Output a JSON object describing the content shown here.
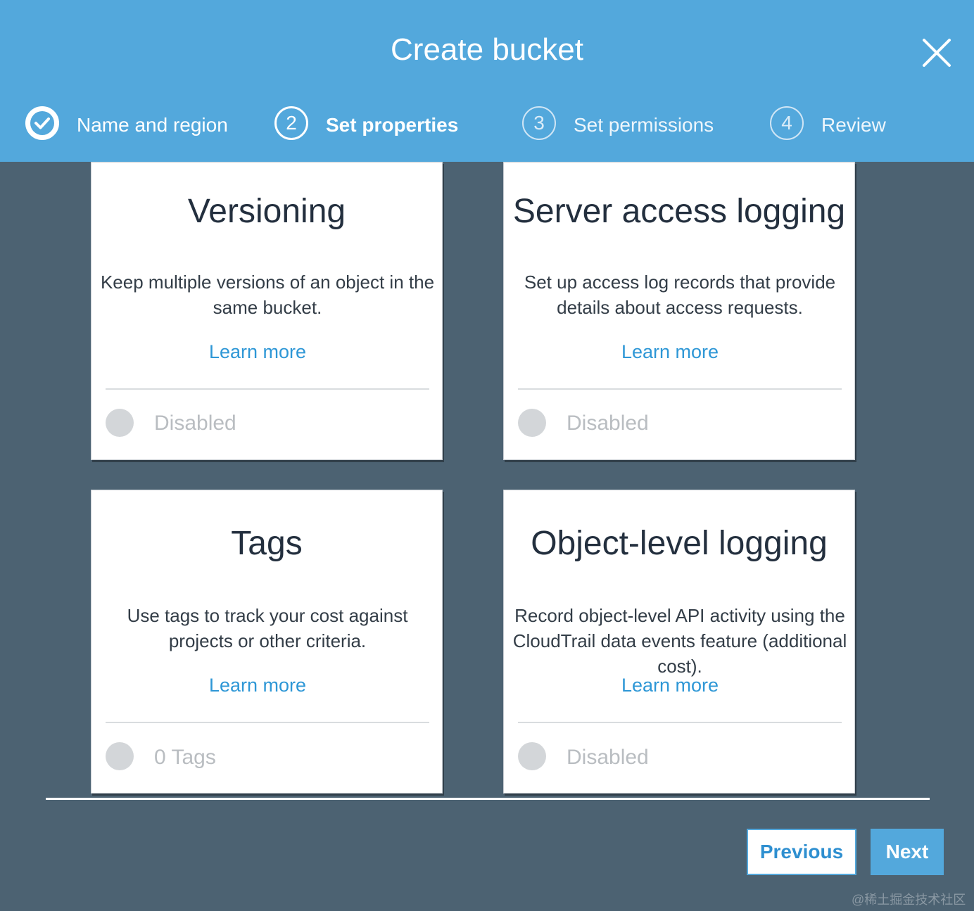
{
  "dialog": {
    "title": "Create bucket"
  },
  "steps": [
    {
      "number": "",
      "label": "Name and region",
      "state": "done"
    },
    {
      "number": "2",
      "label": "Set properties",
      "state": "active"
    },
    {
      "number": "3",
      "label": "Set permissions",
      "state": "inactive"
    },
    {
      "number": "4",
      "label": "Review",
      "state": "inactive"
    }
  ],
  "cards": [
    {
      "title": "Versioning",
      "description": "Keep multiple versions of an object in the same bucket.",
      "link": "Learn more",
      "status": "Disabled"
    },
    {
      "title": "Server access logging",
      "description": "Set up access log records that provide details about access requests.",
      "link": "Learn more",
      "status": "Disabled"
    },
    {
      "title": "Tags",
      "description": "Use tags to track your cost against projects or other criteria.",
      "link": "Learn more",
      "status": "0 Tags"
    },
    {
      "title": "Object-level logging",
      "description": "Record object-level API activity using the CloudTrail data events feature (additional cost).",
      "link": "Learn more",
      "status": "Disabled"
    }
  ],
  "footer": {
    "previous_label": "Previous",
    "next_label": "Next"
  },
  "watermark": "@稀土掘金技术社区",
  "colors": {
    "header": "#53a8dc",
    "background": "#4c6272",
    "link": "#2e97d6",
    "toggle_off": "#d3d6d9"
  },
  "icons": {
    "close": "close-icon",
    "step_done": "check-circle-icon"
  }
}
